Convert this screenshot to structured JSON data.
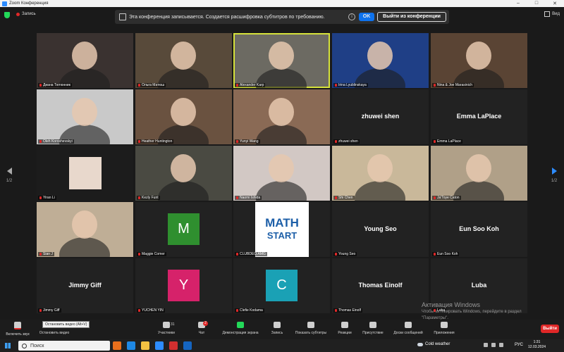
{
  "window": {
    "title": "Zoom Конференция"
  },
  "topbar": {
    "recording_label": "Запись",
    "banner_text": "Эта конференция записывается. Создается расшифровка субтитров по требованию.",
    "ok_label": "OK",
    "leave_conference_label": "Выйти из конференции",
    "view_label": "Вид"
  },
  "pagination": {
    "left_label": "1/2",
    "right_label": "1/2"
  },
  "tiles": [
    {
      "name": "Диана Тютюнник",
      "type": "video",
      "bg": "#3a3230"
    },
    {
      "name": "Ольга Матюш",
      "type": "video",
      "bg": "#584a3a"
    },
    {
      "name": "Alexander Karp",
      "type": "video",
      "bg": "#6c6a62",
      "active": true
    },
    {
      "name": "Irina Lyublinskaya",
      "type": "video",
      "bg": "#1f3f86"
    },
    {
      "name": "Nina & Joe Marasinich",
      "type": "video",
      "bg": "#5a4434"
    },
    {
      "name": "Oleh Koroshevskyi",
      "type": "video",
      "bg": "#c9c9c9"
    },
    {
      "name": "Heather Huntington",
      "type": "video",
      "bg": "#6a5240"
    },
    {
      "name": "Yunyi Wang",
      "type": "video",
      "bg": "#8a6a55"
    },
    {
      "name": "zhuwei shen",
      "type": "name",
      "display": "zhuwei shen"
    },
    {
      "name": "Emma LaPlace",
      "type": "name",
      "display": "Emma LaPlace"
    },
    {
      "name": "Yiran Li",
      "type": "thumb",
      "bg": "#1c1c1c"
    },
    {
      "name": "Kezly Funt",
      "type": "video",
      "bg": "#4a4a42"
    },
    {
      "name": "Naomi Ishida",
      "type": "video",
      "bg": "#d2c8c4"
    },
    {
      "name": "Shi Chen",
      "type": "video",
      "bg": "#c9b89a"
    },
    {
      "name": "Ja'Toye Caton",
      "type": "video",
      "bg": "#b0a088"
    },
    {
      "name": "Sian J",
      "type": "video",
      "bg": "#bfae96"
    },
    {
      "name": "Maggie Comer",
      "type": "letter",
      "letter": "M",
      "color": "#2f8f2f"
    },
    {
      "name": "CLUBDEQ.AMG",
      "type": "logo",
      "logo_top": "MATH",
      "logo_bottom": "START"
    },
    {
      "name": "Young Seo",
      "type": "name",
      "display": "Young Seo"
    },
    {
      "name": "Eun Soo Koh",
      "type": "name",
      "display": "Eun Soo Koh"
    },
    {
      "name": "Jimmy Giff",
      "type": "name",
      "display": "Jimmy Giff"
    },
    {
      "name": "YUCHEN YIN",
      "type": "letter",
      "letter": "Y",
      "color": "#d6226a"
    },
    {
      "name": "Clefie Kodama",
      "type": "letter",
      "letter": "C",
      "color": "#1aa1b5"
    },
    {
      "name": "Thomas Einolf",
      "type": "name",
      "display": "Thomas Einolf"
    },
    {
      "name": "Luba",
      "type": "name",
      "display": "Luba"
    }
  ],
  "toolbar": {
    "unmute_label": "Включить звук",
    "stop_video_label": "Остановить видео",
    "tooltip": "Остановить видео (Alt+V)",
    "participants_label": "Участники",
    "participants_count": "31",
    "chat_label": "Чат",
    "chat_badge": "2",
    "share_label": "Демонстрация экрана",
    "record_label": "Запись",
    "captions_label": "Показать субтитры",
    "reactions_label": "Реакции",
    "immersive_label": "Присутствие",
    "whiteboard_label": "Доски сообщений",
    "apps_label": "Приложения",
    "leave_label": "Выйти"
  },
  "watermark": {
    "title": "Активация Windows",
    "line1": "Чтобы активировать Windows, перейдите в раздел",
    "line2": "\"Параметры\"."
  },
  "taskbar": {
    "search_placeholder": "Поиск",
    "weather": "Cold weather",
    "language": "РУС",
    "time": "1:31",
    "date": "12.03.2024"
  }
}
